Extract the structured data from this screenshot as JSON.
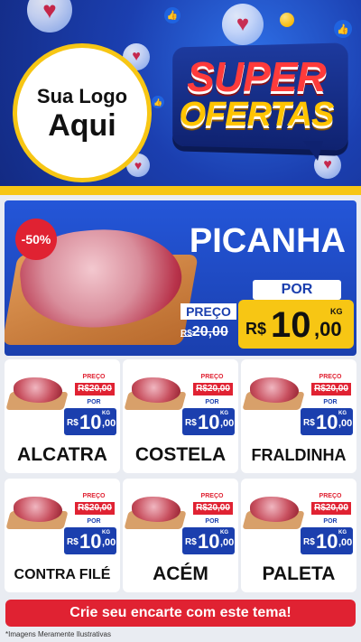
{
  "header": {
    "logo_line1": "Sua Logo",
    "logo_line2": "Aqui",
    "badge_line1": "SUPER",
    "badge_line2": "OFERTAS"
  },
  "hero": {
    "discount": "-50%",
    "name": "PICANHA",
    "preco_label": "PREÇO",
    "old_currency": "R$",
    "old_price": "20,00",
    "por_label": "POR",
    "currency": "R$",
    "price_int": "10",
    "price_cents": ",00",
    "unit": "KG"
  },
  "products": [
    {
      "name": "ALCATRA",
      "preco_label": "PREÇO",
      "old_price": "R$20,00",
      "por_label": "POR",
      "currency": "R$",
      "price_int": "10",
      "price_cents": ",00",
      "unit": "KG"
    },
    {
      "name": "COSTELA",
      "preco_label": "PREÇO",
      "old_price": "R$20,00",
      "por_label": "POR",
      "currency": "R$",
      "price_int": "10",
      "price_cents": ",00",
      "unit": "KG"
    },
    {
      "name": "FRALDINHA",
      "preco_label": "PREÇO",
      "old_price": "R$20,00",
      "por_label": "POR",
      "currency": "R$",
      "price_int": "10",
      "price_cents": ",00",
      "unit": "KG"
    },
    {
      "name": "CONTRA FILÉ",
      "preco_label": "PREÇO",
      "old_price": "R$20,00",
      "por_label": "POR",
      "currency": "R$",
      "price_int": "10",
      "price_cents": ",00",
      "unit": "KG"
    },
    {
      "name": "ACÉM",
      "preco_label": "PREÇO",
      "old_price": "R$20,00",
      "por_label": "POR",
      "currency": "R$",
      "price_int": "10",
      "price_cents": ",00",
      "unit": "KG"
    },
    {
      "name": "PALETA",
      "preco_label": "PREÇO",
      "old_price": "R$20,00",
      "por_label": "POR",
      "currency": "R$",
      "price_int": "10",
      "price_cents": ",00",
      "unit": "KG"
    }
  ],
  "footer": {
    "cta": "Crie seu encarte com este tema!",
    "disclaimer": "*Imagens Meramente Ilustrativas"
  },
  "colors": {
    "primary_blue": "#1b3fae",
    "accent_yellow": "#f7c614",
    "accent_red": "#e02232"
  },
  "icons": [
    "heart-icon",
    "like-icon",
    "emoji-icon"
  ]
}
